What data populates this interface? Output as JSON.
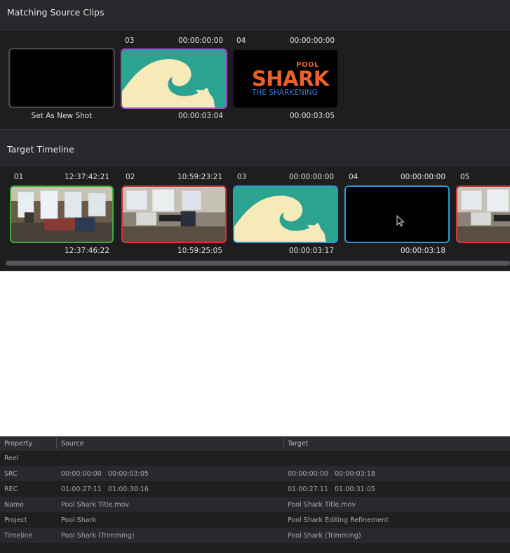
{
  "matching": {
    "title": "Matching Source Clips",
    "set_as_new_shot": "Set As New Shot",
    "clips": [
      {
        "num": "03",
        "tc_in": "00:00:00:00",
        "tc_out": "00:00:03:04",
        "thumb": "wave"
      },
      {
        "num": "04",
        "tc_in": "00:00:00:00",
        "tc_out": "00:00:03:05",
        "thumb": "title"
      }
    ],
    "title_card": {
      "small": "POOL",
      "big": "SHARK",
      "sub": "THE SHARKENING"
    }
  },
  "timeline": {
    "title": "Target Timeline",
    "clips": [
      {
        "num": "01",
        "tc_in": "12:37:42:21",
        "tc_out": "12:37:46:22",
        "thumb": "office-window",
        "border": "#3ab03a"
      },
      {
        "num": "02",
        "tc_in": "10:59:23:21",
        "tc_out": "10:59:25:05",
        "thumb": "office-desk",
        "border": "#d0383c"
      },
      {
        "num": "03",
        "tc_in": "00:00:00:00",
        "tc_out": "00:00:03:17",
        "thumb": "wave",
        "border": "#2f9ad6"
      },
      {
        "num": "04",
        "tc_in": "00:00:00:00",
        "tc_out": "00:00:03:18",
        "thumb": "black",
        "border": "#2f9ad6"
      },
      {
        "num": "05",
        "tc_in": "",
        "tc_out": "",
        "thumb": "office-desk",
        "border": "#d0383c"
      }
    ],
    "cursor_icon": "pointer-cursor-icon"
  },
  "table": {
    "headers": [
      "Property",
      "Source",
      "Target"
    ],
    "rows": [
      {
        "property": "Reel",
        "source": "",
        "target": ""
      },
      {
        "property": "SRC",
        "source": "00:00:00:00   00:00:03:05",
        "target": "00:00:00:00   00:00:03:18"
      },
      {
        "property": "REC",
        "source": "01:00:27:11   01:00:30:16",
        "target": "01:00:27:11   01:00:31:05"
      },
      {
        "property": "Name",
        "source": "Pool Shark Title.mov",
        "target": "Pool Shark Title.mov"
      },
      {
        "property": "Project",
        "source": "Pool Shark",
        "target": "Pool Shark Editing Refinement"
      },
      {
        "property": "Timeline",
        "source": "Pool Shark (Trimming)",
        "target": "Pool Shark (Trimming)"
      }
    ]
  },
  "colors": {
    "panel_bg": "#28282c",
    "strip_bg": "#1e1e21",
    "purple_selected": "#a24bd0",
    "green": "#3ab03a",
    "red": "#d0383c",
    "blue": "#2f9ad6",
    "shark_orange": "#e8622a",
    "shark_blue": "#3f78d8",
    "wave_teal": "#2aa391",
    "wave_cream": "#f6eab8"
  }
}
